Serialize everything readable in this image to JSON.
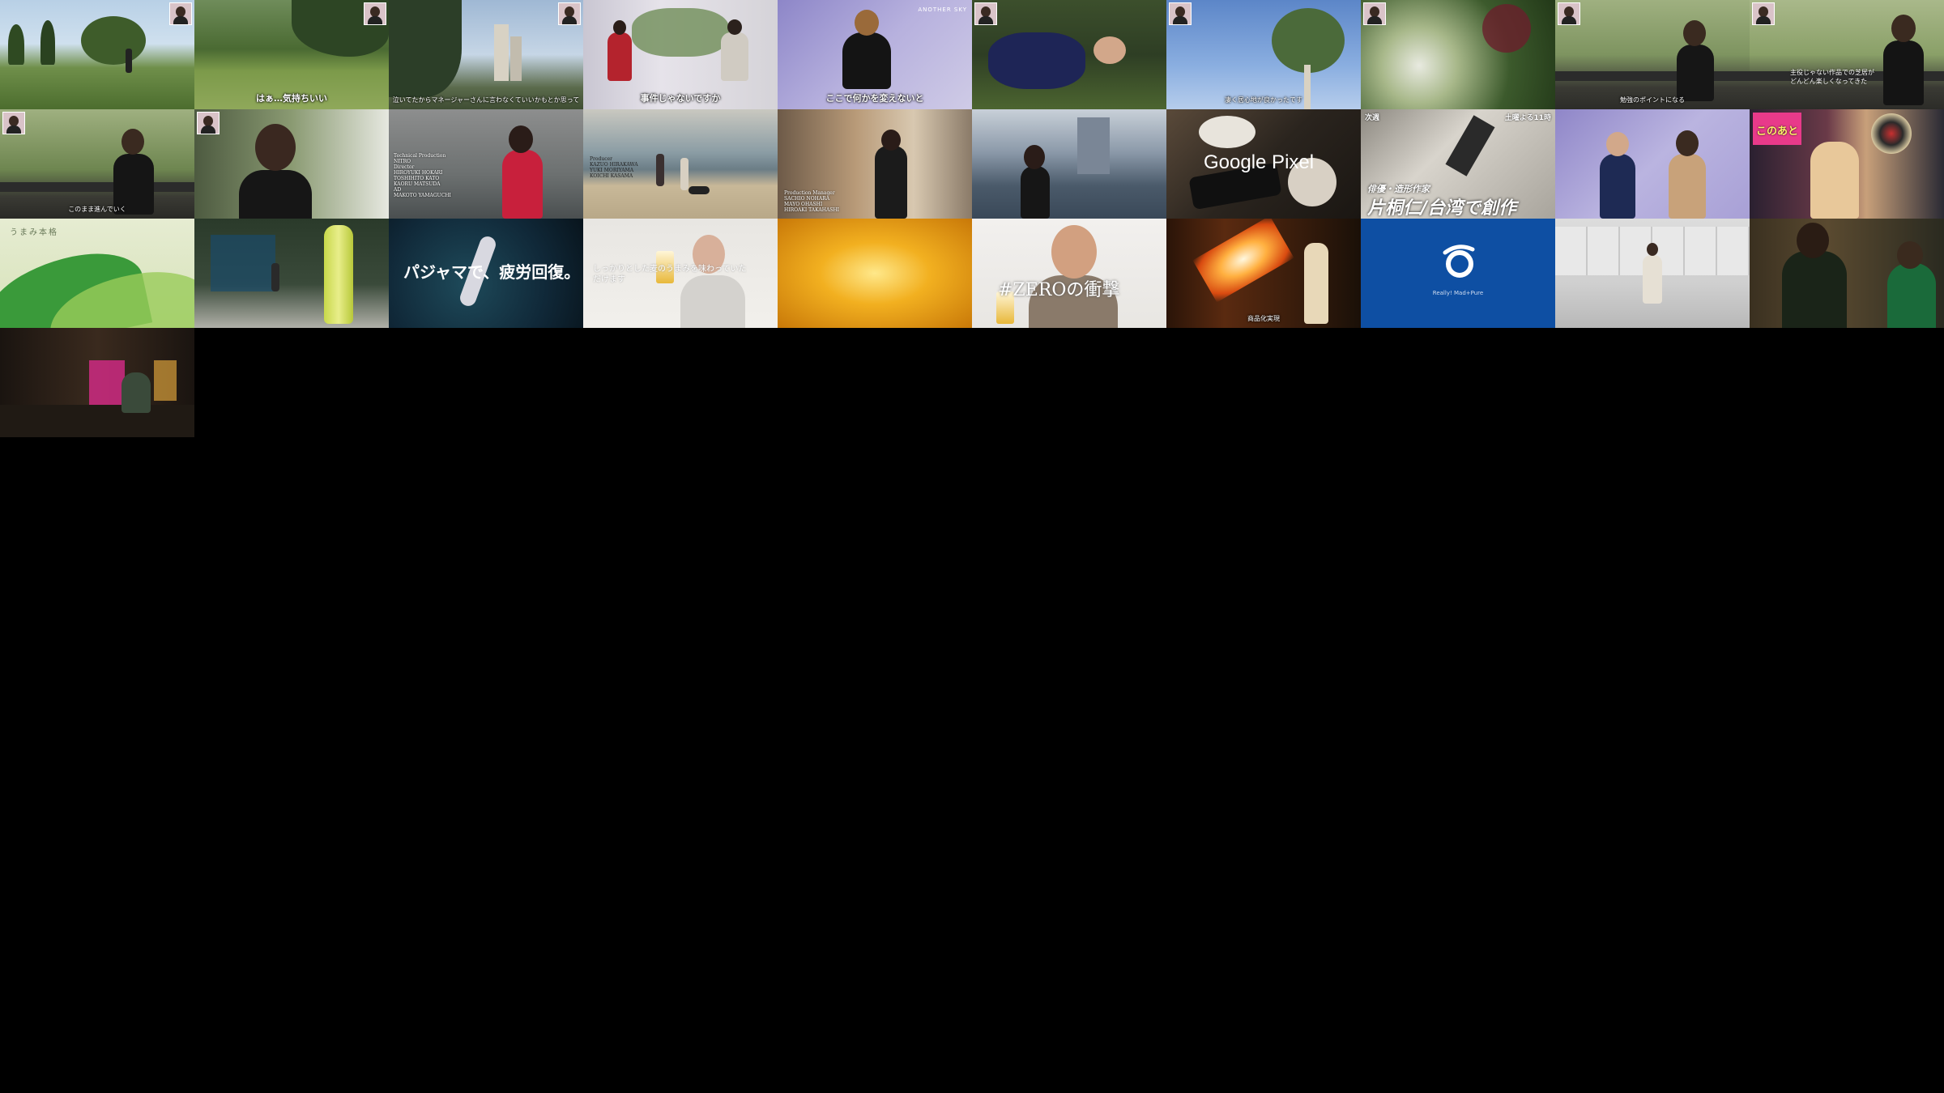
{
  "thumbnails": [
    {
      "id": 1,
      "scene": "park",
      "caption": ""
    },
    {
      "id": 2,
      "scene": "park-lawn",
      "caption": "はぁ…気持ちいい"
    },
    {
      "id": 3,
      "scene": "city-trees",
      "caption": "泣いてたからマネージャーさんに言わなくていいかもとか思って"
    },
    {
      "id": 4,
      "scene": "interview-duo",
      "caption": "事件じゃないですか"
    },
    {
      "id": 5,
      "scene": "interview-woman",
      "caption": "ここで何かを変えないと",
      "tag": "ANOTHER SKY"
    },
    {
      "id": 6,
      "scene": "lying-grass",
      "caption": ""
    },
    {
      "id": 7,
      "scene": "sky-tree",
      "caption": "凄く居心地が良かったです"
    },
    {
      "id": 8,
      "scene": "plants",
      "caption": ""
    },
    {
      "id": 9,
      "scene": "bench-woman",
      "caption": "勉強のポイントになる"
    },
    {
      "id": 10,
      "scene": "bench-woman-2",
      "caption": "主役じゃない作品での芝居が どんどん楽しくなってきた"
    },
    {
      "id": 11,
      "scene": "bench-park",
      "caption": "このまま進んでいく"
    },
    {
      "id": 12,
      "scene": "closeup-woman",
      "caption": ""
    },
    {
      "id": 13,
      "scene": "credits-red",
      "credits": "Technical Production\nNITRO\nDirector\nHIROYUKI HOKARI\nTOSHIHITO KATO\nKAORU MATSUDA\nAD\nMAKOTO YAMAGUCHI"
    },
    {
      "id": 14,
      "scene": "beach-dog",
      "credits": "Producer\nKAZUO HIRAKAWA\nYUKI MORIYAMA\nKOICHI KASAMA"
    },
    {
      "id": 15,
      "scene": "shop",
      "credits": "Production Manager\nSACHIO NOHARA\nMAYO OHASHI\nHIROAKI TAKAHASHI"
    },
    {
      "id": 16,
      "scene": "river-city",
      "caption": ""
    },
    {
      "id": 17,
      "scene": "google-pixel",
      "brand": "Google Pixel"
    },
    {
      "id": 18,
      "scene": "next-episode",
      "next_label": "次週",
      "airtime": "土曜よる11時",
      "subtitle": "俳優・造形作家",
      "headline": "片桐仁/台湾で創作"
    },
    {
      "id": 19,
      "scene": "studio-duo",
      "caption": ""
    },
    {
      "id": 20,
      "scene": "variety",
      "promo": "このあと"
    },
    {
      "id": 21,
      "scene": "green-wave",
      "tagline": "うまみ本格"
    },
    {
      "id": 22,
      "scene": "tea-bottle",
      "caption": ""
    },
    {
      "id": 23,
      "scene": "pajama",
      "headline": "パジャマで、疲労回復。"
    },
    {
      "id": 24,
      "scene": "beer-man",
      "caption": "しっかりとした麦のうまみを味わっていただけます"
    },
    {
      "id": 25,
      "scene": "golden-pour",
      "caption": ""
    },
    {
      "id": 26,
      "scene": "zero-man",
      "headline": "#ZEROの衝撃"
    },
    {
      "id": 27,
      "scene": "fire",
      "caption": "商品化実現"
    },
    {
      "id": 28,
      "scene": "asahi-logo",
      "tagline": "Really! Mad+Pure"
    },
    {
      "id": 29,
      "scene": "white-room",
      "caption": ""
    },
    {
      "id": 30,
      "scene": "bar-men",
      "caption": ""
    },
    {
      "id": 31,
      "scene": "neon-bar",
      "caption": ""
    }
  ],
  "colors": {
    "background": "#000000",
    "caption": "#ffffff",
    "asahi_blue": "#0e4fa3"
  }
}
